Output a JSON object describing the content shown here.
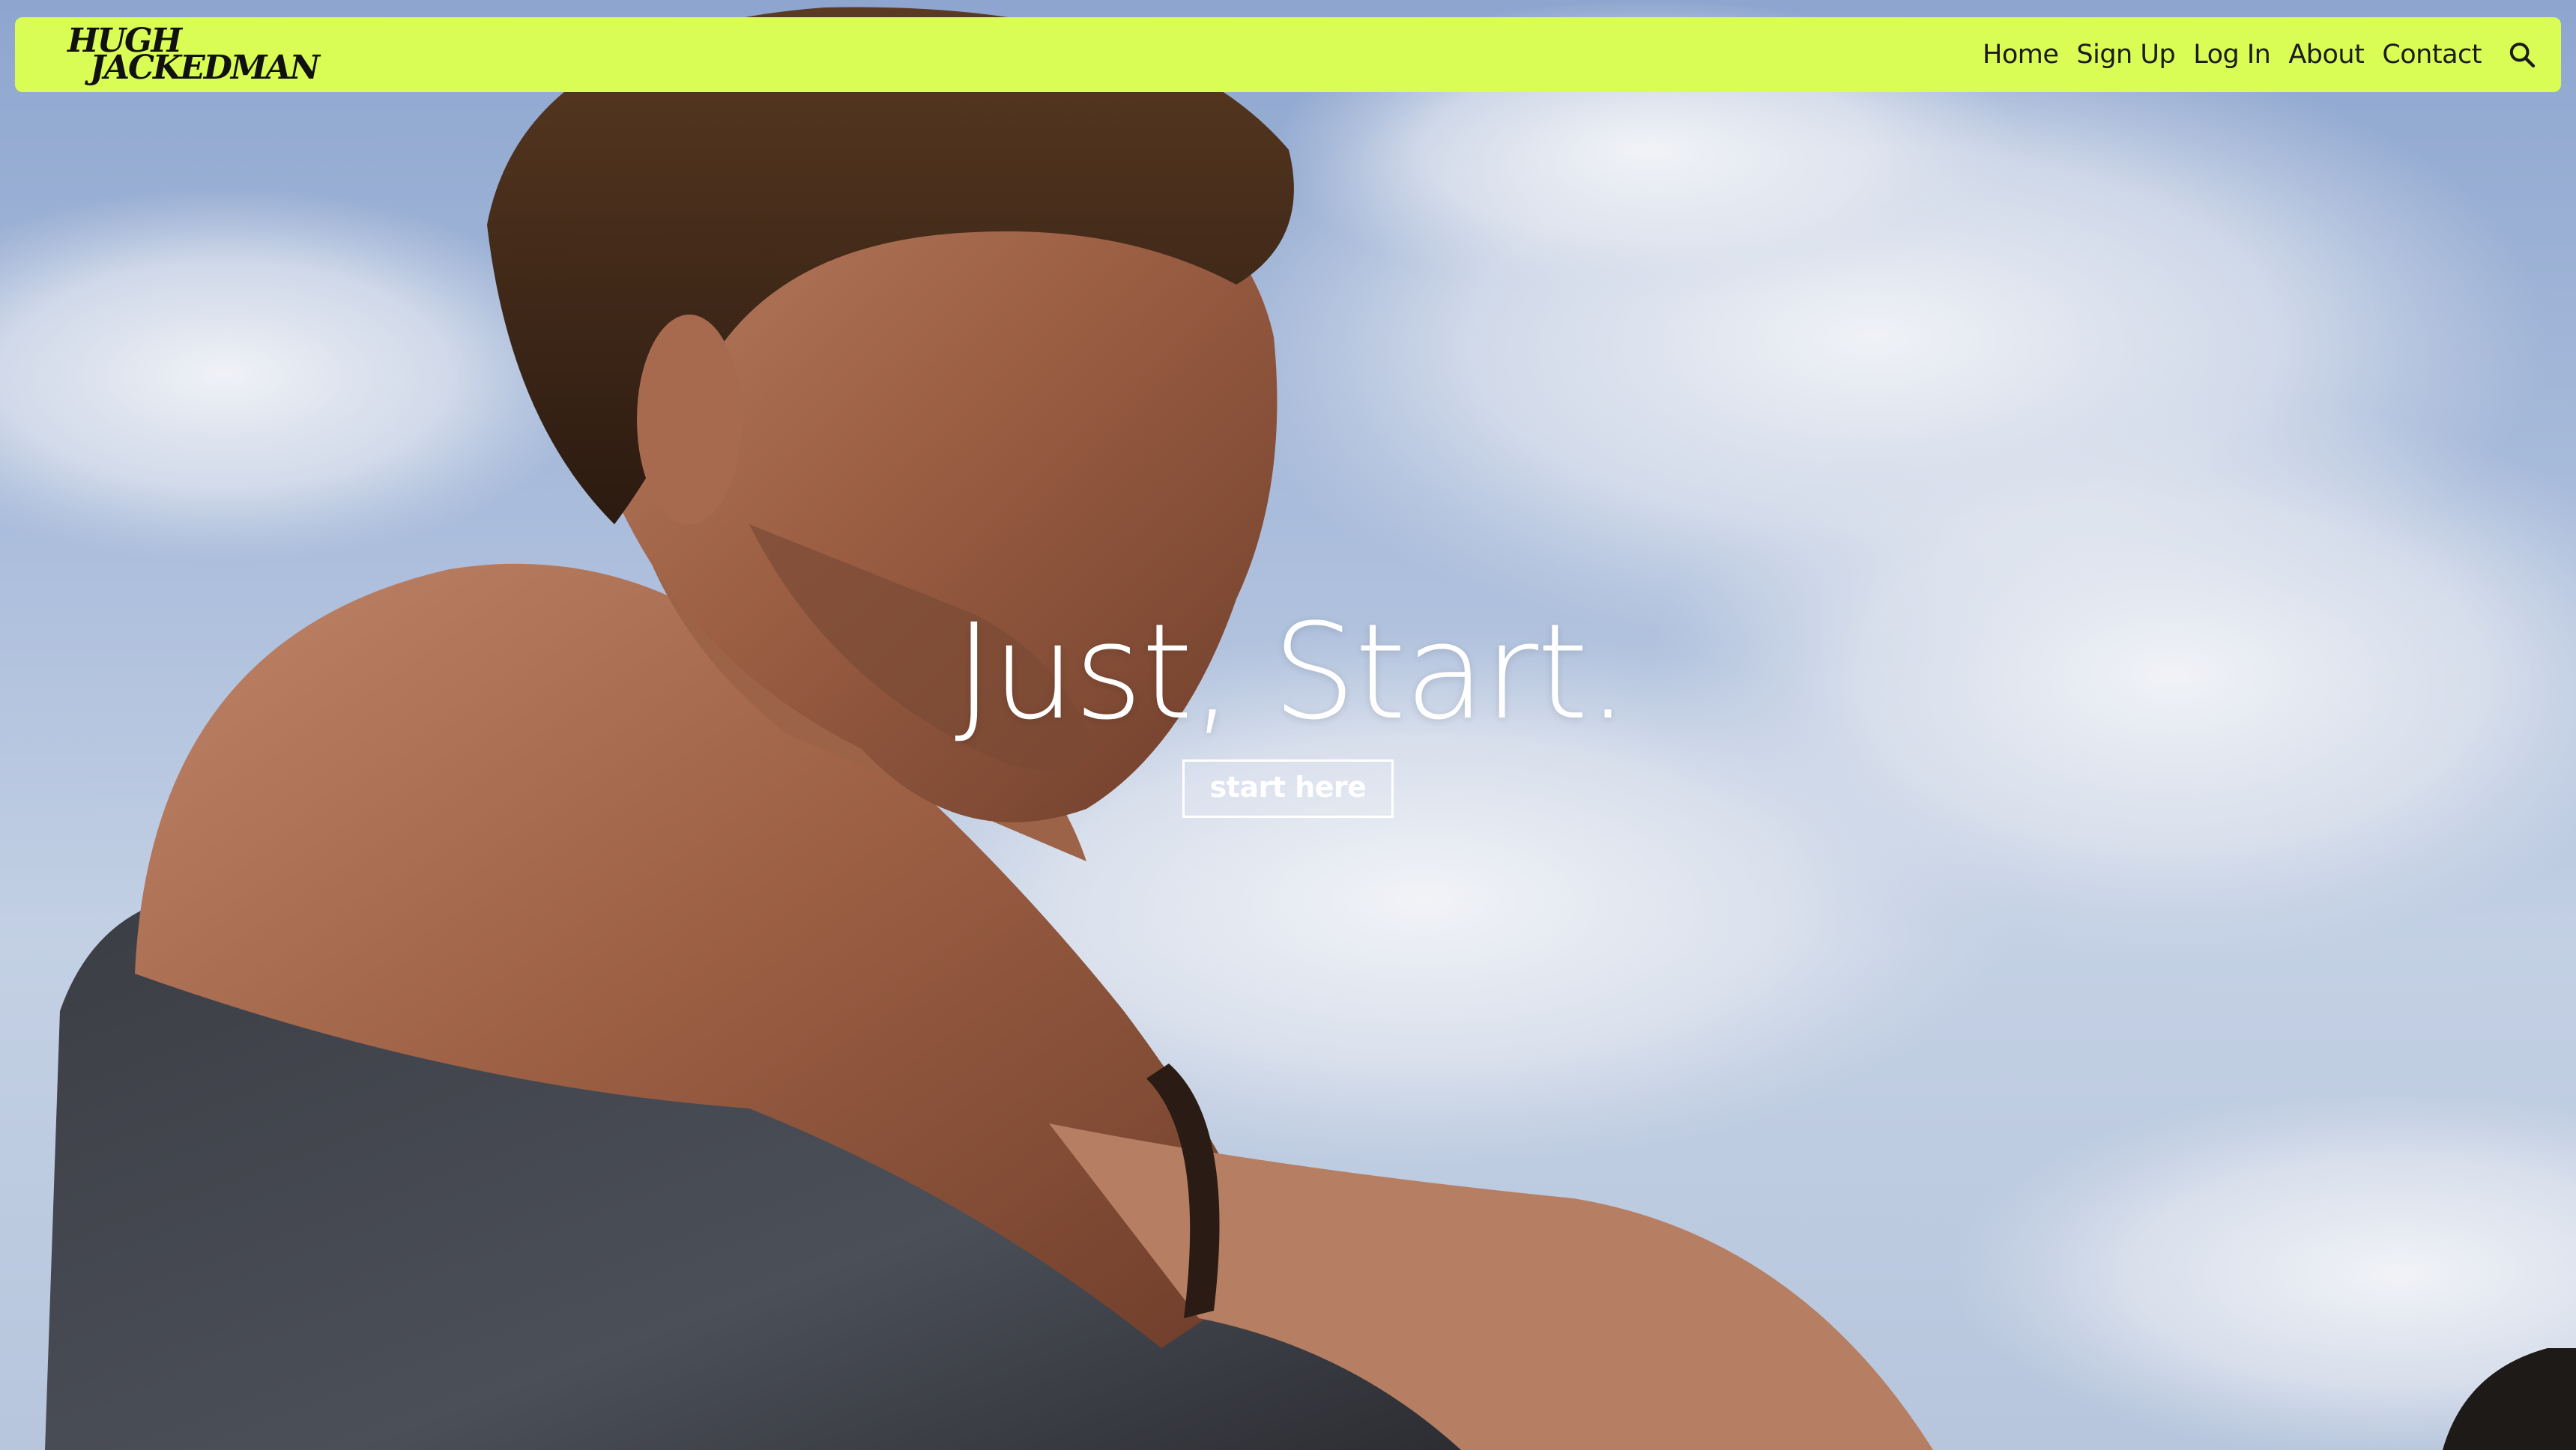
{
  "brand": {
    "logo_line1": "HUGH",
    "logo_line2": "JACKEDMAN",
    "accent_color": "#d9fd55"
  },
  "nav": {
    "items": [
      {
        "label": "Home"
      },
      {
        "label": "Sign Up"
      },
      {
        "label": "Log In"
      },
      {
        "label": "About"
      },
      {
        "label": "Contact"
      }
    ],
    "search_icon": "search-icon"
  },
  "hero": {
    "title": "Just, Start.",
    "cta_label": "start here",
    "background": "man-boxing-against-sky-photo"
  }
}
